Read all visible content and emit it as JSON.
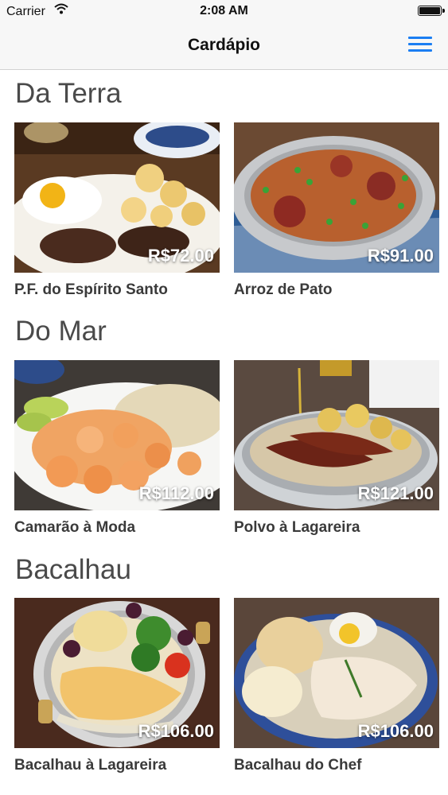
{
  "status": {
    "carrier": "Carrier",
    "time": "2:08 AM"
  },
  "nav": {
    "title": "Cardápio"
  },
  "sections": [
    {
      "title": "Da Terra",
      "items": [
        {
          "name": "P.F. do Espírito Santo",
          "price": "R$72.00"
        },
        {
          "name": "Arroz de Pato",
          "price": "R$91.00"
        }
      ]
    },
    {
      "title": "Do Mar",
      "items": [
        {
          "name": "Camarão à Moda",
          "price": "R$112.00"
        },
        {
          "name": "Polvo à Lagareira",
          "price": "R$121.00"
        }
      ]
    },
    {
      "title": "Bacalhau",
      "items": [
        {
          "name": "Bacalhau à Lagareira",
          "price": "R$106.00"
        },
        {
          "name": "Bacalhau do Chef",
          "price": "R$106.00"
        }
      ]
    }
  ]
}
